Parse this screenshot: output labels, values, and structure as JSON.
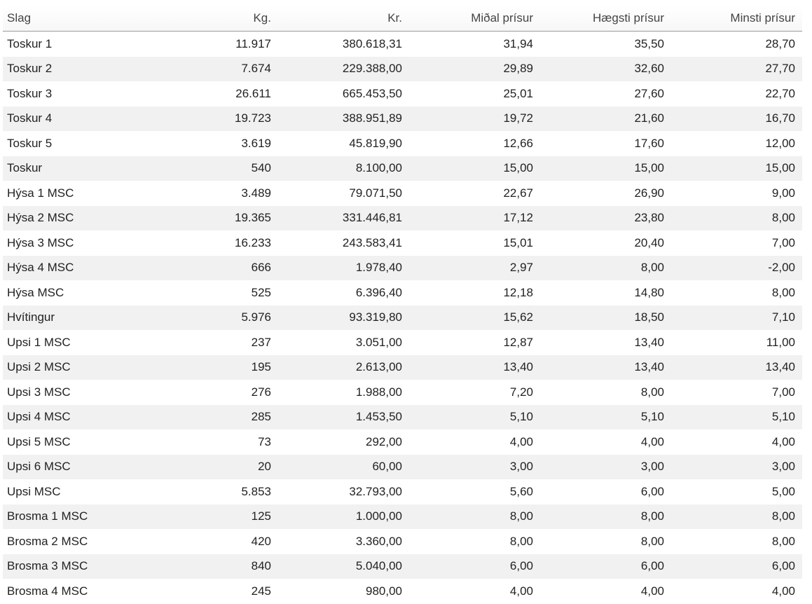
{
  "table": {
    "columns": [
      "Slag",
      "Kg.",
      "Kr.",
      "Miðal prísur",
      "Hægsti prísur",
      "Minsti prísur"
    ],
    "rows": [
      [
        "Toskur 1",
        "11.917",
        "380.618,31",
        "31,94",
        "35,50",
        "28,70"
      ],
      [
        "Toskur 2",
        "7.674",
        "229.388,00",
        "29,89",
        "32,60",
        "27,70"
      ],
      [
        "Toskur 3",
        "26.611",
        "665.453,50",
        "25,01",
        "27,60",
        "22,70"
      ],
      [
        "Toskur 4",
        "19.723",
        "388.951,89",
        "19,72",
        "21,60",
        "16,70"
      ],
      [
        "Toskur 5",
        "3.619",
        "45.819,90",
        "12,66",
        "17,60",
        "12,00"
      ],
      [
        "Toskur",
        "540",
        "8.100,00",
        "15,00",
        "15,00",
        "15,00"
      ],
      [
        "Hýsa 1 MSC",
        "3.489",
        "79.071,50",
        "22,67",
        "26,90",
        "9,00"
      ],
      [
        "Hýsa 2 MSC",
        "19.365",
        "331.446,81",
        "17,12",
        "23,80",
        "8,00"
      ],
      [
        "Hýsa 3 MSC",
        "16.233",
        "243.583,41",
        "15,01",
        "20,40",
        "7,00"
      ],
      [
        "Hýsa 4 MSC",
        "666",
        "1.978,40",
        "2,97",
        "8,00",
        "-2,00"
      ],
      [
        "Hýsa MSC",
        "525",
        "6.396,40",
        "12,18",
        "14,80",
        "8,00"
      ],
      [
        "Hvítingur",
        "5.976",
        "93.319,80",
        "15,62",
        "18,50",
        "7,10"
      ],
      [
        "Upsi 1 MSC",
        "237",
        "3.051,00",
        "12,87",
        "13,40",
        "11,00"
      ],
      [
        "Upsi 2 MSC",
        "195",
        "2.613,00",
        "13,40",
        "13,40",
        "13,40"
      ],
      [
        "Upsi 3 MSC",
        "276",
        "1.988,00",
        "7,20",
        "8,00",
        "7,00"
      ],
      [
        "Upsi 4 MSC",
        "285",
        "1.453,50",
        "5,10",
        "5,10",
        "5,10"
      ],
      [
        "Upsi 5 MSC",
        "73",
        "292,00",
        "4,00",
        "4,00",
        "4,00"
      ],
      [
        "Upsi 6 MSC",
        "20",
        "60,00",
        "3,00",
        "3,00",
        "3,00"
      ],
      [
        "Upsi MSC",
        "5.853",
        "32.793,00",
        "5,60",
        "6,00",
        "5,00"
      ],
      [
        "Brosma 1 MSC",
        "125",
        "1.000,00",
        "8,00",
        "8,00",
        "8,00"
      ],
      [
        "Brosma 2 MSC",
        "420",
        "3.360,00",
        "8,00",
        "8,00",
        "8,00"
      ],
      [
        "Brosma 3 MSC",
        "840",
        "5.040,00",
        "6,00",
        "6,00",
        "6,00"
      ],
      [
        "Brosma 4 MSC",
        "245",
        "980,00",
        "4,00",
        "4,00",
        "4,00"
      ]
    ]
  }
}
